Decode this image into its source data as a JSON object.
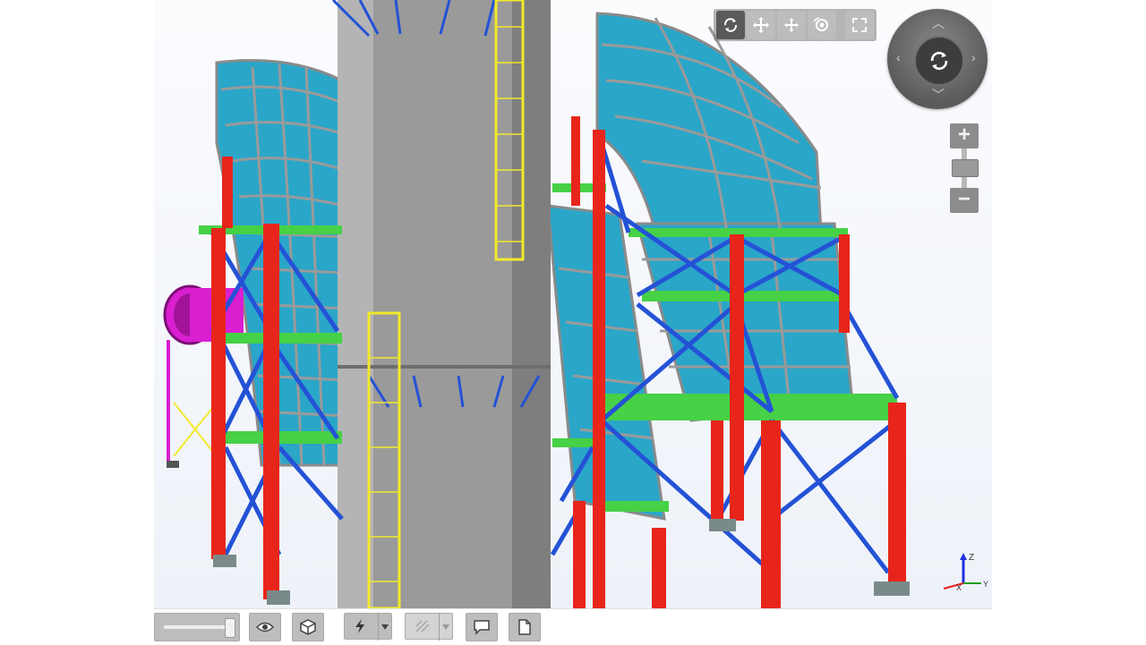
{
  "viewer": {
    "colors": {
      "background": "#f3f6fb",
      "column": "#e8251b",
      "bracing": "#2452d6",
      "beam": "#46d146",
      "panel": "#2aa6c8",
      "chimney": "#9a9a9a",
      "ladder": "#f2e92a",
      "duct": "#d91fd0",
      "toolbar": "#bdbdbd"
    }
  },
  "nav_toolbar": {
    "tools": [
      {
        "icon": "orbit-icon",
        "active": true
      },
      {
        "icon": "pan-icon",
        "active": false
      },
      {
        "icon": "move-icon",
        "active": false
      },
      {
        "icon": "look-around-icon",
        "active": false
      },
      {
        "icon": "fullscreen-icon",
        "active": false
      }
    ]
  },
  "view_cube": {
    "center_icon": "orbit-icon",
    "arrows": [
      "up-arrow",
      "down-arrow",
      "left-arrow",
      "right-arrow"
    ]
  },
  "zoom": {
    "in_label": "+",
    "out_label": "−"
  },
  "axis_triad": {
    "z": "Z",
    "x": "X",
    "y": "Y",
    "colors": {
      "x": "#e82020",
      "y": "#20a020",
      "z": "#2030e0"
    }
  },
  "bottom_toolbar": {
    "slider_value": 1.0,
    "tools": [
      {
        "icon": "eye-icon"
      },
      {
        "icon": "cube-icon"
      },
      {
        "icon": "lightning-icon",
        "dropdown": true
      },
      {
        "icon": "markup-icon",
        "dropdown": true,
        "disabled": true
      },
      {
        "icon": "comment-icon"
      },
      {
        "icon": "document-icon"
      }
    ]
  }
}
